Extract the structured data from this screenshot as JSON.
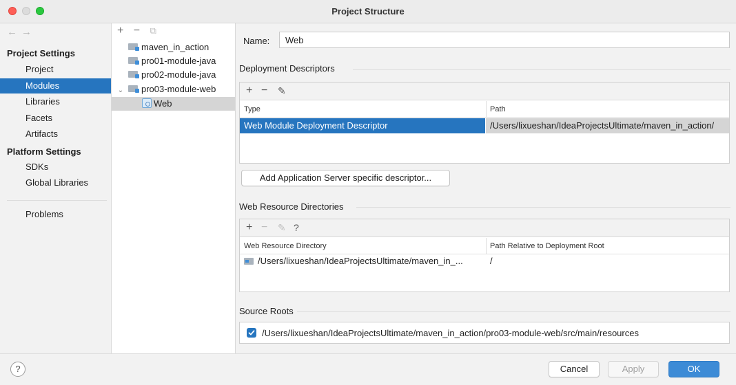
{
  "window": {
    "title": "Project Structure"
  },
  "nav": {
    "back": "←",
    "forward": "→"
  },
  "sidebar": {
    "project_settings_header": "Project Settings",
    "platform_settings_header": "Platform Settings",
    "items": [
      {
        "label": "Project"
      },
      {
        "label": "Modules",
        "selected": true
      },
      {
        "label": "Libraries"
      },
      {
        "label": "Facets"
      },
      {
        "label": "Artifacts"
      },
      {
        "label": "SDKs"
      },
      {
        "label": "Global Libraries"
      },
      {
        "label": "Problems"
      }
    ]
  },
  "tree": {
    "toolbar": {
      "add": "+",
      "remove": "−",
      "copy": "⧉"
    },
    "modules": [
      {
        "label": "maven_in_action"
      },
      {
        "label": "pro01-module-java"
      },
      {
        "label": "pro02-module-java"
      },
      {
        "label": "pro03-module-web",
        "expanded": true,
        "chevron": "⌄"
      },
      {
        "label": "Web",
        "selected": true
      }
    ]
  },
  "detail": {
    "name_label": "Name:",
    "name_value": "Web",
    "deployment": {
      "header": "Deployment Descriptors",
      "toolbar": {
        "add": "+",
        "remove": "−",
        "edit": "✎"
      },
      "columns": [
        "Type",
        "Path"
      ],
      "rows": [
        {
          "type": "Web Module Deployment Descriptor",
          "path": "/Users/lixueshan/IdeaProjectsUltimate/maven_in_action/"
        }
      ],
      "add_server_button": "Add Application Server specific descriptor..."
    },
    "web_resources": {
      "header": "Web Resource Directories",
      "toolbar": {
        "add": "+",
        "remove": "−",
        "edit": "✎",
        "help": "?"
      },
      "columns": [
        "Web Resource Directory",
        "Path Relative to Deployment Root"
      ],
      "rows": [
        {
          "directory": "/Users/lixueshan/IdeaProjectsUltimate/maven_in_...",
          "relative": "/"
        }
      ]
    },
    "source_roots": {
      "header": "Source Roots",
      "items": [
        {
          "checked": true,
          "path": "/Users/lixueshan/IdeaProjectsUltimate/maven_in_action/pro03-module-web/src/main/resources"
        }
      ]
    }
  },
  "footer": {
    "help": "?",
    "cancel": "Cancel",
    "apply": "Apply",
    "ok": "OK"
  },
  "colors": {
    "accent": "#2675bf",
    "ok_button": "#3d8bd6",
    "close": "#fe5f57",
    "maximize": "#2ac840"
  }
}
